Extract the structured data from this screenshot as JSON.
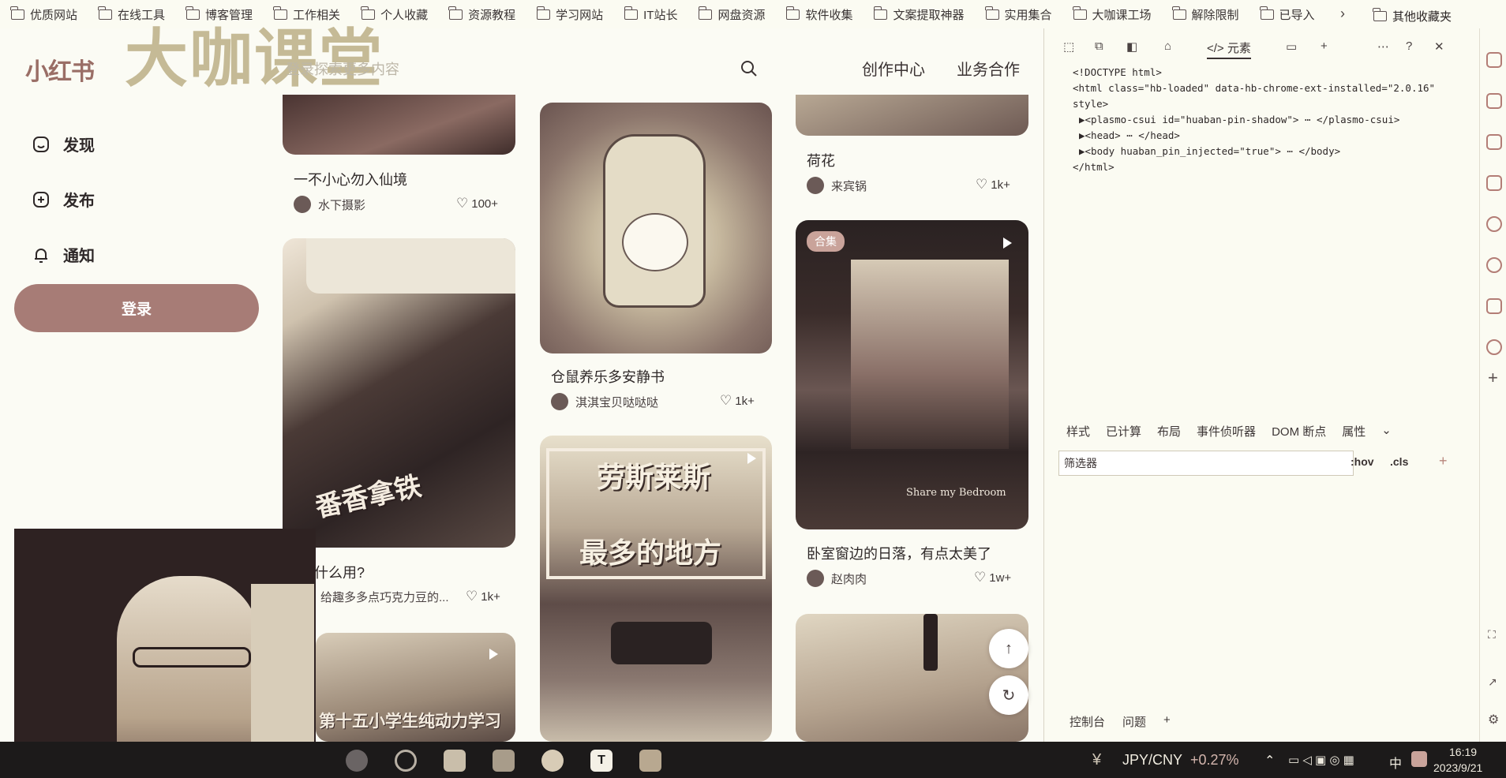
{
  "bookmarks": {
    "items": [
      "优质网站",
      "在线工具",
      "博客管理",
      "工作相关",
      "个人收藏",
      "资源教程",
      "学习网站",
      "IT站长",
      "网盘资源",
      "软件收集",
      "文案提取神器",
      "实用集合",
      "大咖课工场",
      "解除限制",
      "已导入"
    ],
    "overflow_label": "›",
    "other_label": "其他收藏夹"
  },
  "watermark": "大咖课堂",
  "header": {
    "logo": "小红书",
    "search_placeholder": "登录探索更多内容",
    "creator_link": "创作中心",
    "business_link": "业务合作"
  },
  "nav": {
    "discover": "发现",
    "publish": "发布",
    "notify": "通知",
    "login": "登录"
  },
  "feed": {
    "col1": [
      {
        "title": "一不小心勿入仙境",
        "author": "水下摄影",
        "likes": "100+"
      },
      {
        "title": "什么用?",
        "author": "给趣多多点巧克力豆的...",
        "likes": "1k+"
      },
      {
        "overlay_text": "第十五小学生纯动力学习"
      }
    ],
    "col2": [
      {
        "title": "仓鼠养乐多安静书",
        "author": "淇淇宝贝哒哒哒",
        "likes": "1k+"
      },
      {
        "overlay_text_1": "劳斯莱斯",
        "overlay_text_2": "最多的地方"
      }
    ],
    "col3": [
      {
        "title": "荷花",
        "author": "来宾锅",
        "likes": "1k+"
      },
      {
        "badge": "合集",
        "caption": "Share my Bedroom",
        "title": "卧室窗边的日落，有点太美了",
        "author": "赵肉肉",
        "likes": "1w+"
      }
    ],
    "card2_overlay": "番香拿铁"
  },
  "devtools": {
    "tab_elements": "元素",
    "code_lines": [
      "<!DOCTYPE html>",
      "<html class=\"hb-loaded\" data-hb-chrome-ext-installed=\"2.0.16\"",
      "style>",
      "▶<plasmo-csui id=\"huaban-pin-shadow\"> ⋯ </plasmo-csui>",
      "▶<head> ⋯ </head>",
      "▶<body huaban_pin_injected=\"true\"> ⋯ </body>",
      "</html>"
    ],
    "lower_tabs": [
      "样式",
      "已计算",
      "布局",
      "事件侦听器",
      "DOM 断点",
      "属性"
    ],
    "filter_placeholder": "筛选器",
    "hov": ":hov",
    "cls": ".cls",
    "drawer_tabs": [
      "控制台",
      "问题"
    ]
  },
  "taskbar": {
    "fx_pair": "JPY/CNY",
    "fx_change": "+0.27%",
    "ime": "中",
    "time": "16:19",
    "date": "2023/9/21",
    "search_label": "搜索"
  },
  "colors": {
    "brand": "#a77c76",
    "page_bg": "#fbfbf4",
    "taskbar_bg": "#1c1a1a"
  }
}
